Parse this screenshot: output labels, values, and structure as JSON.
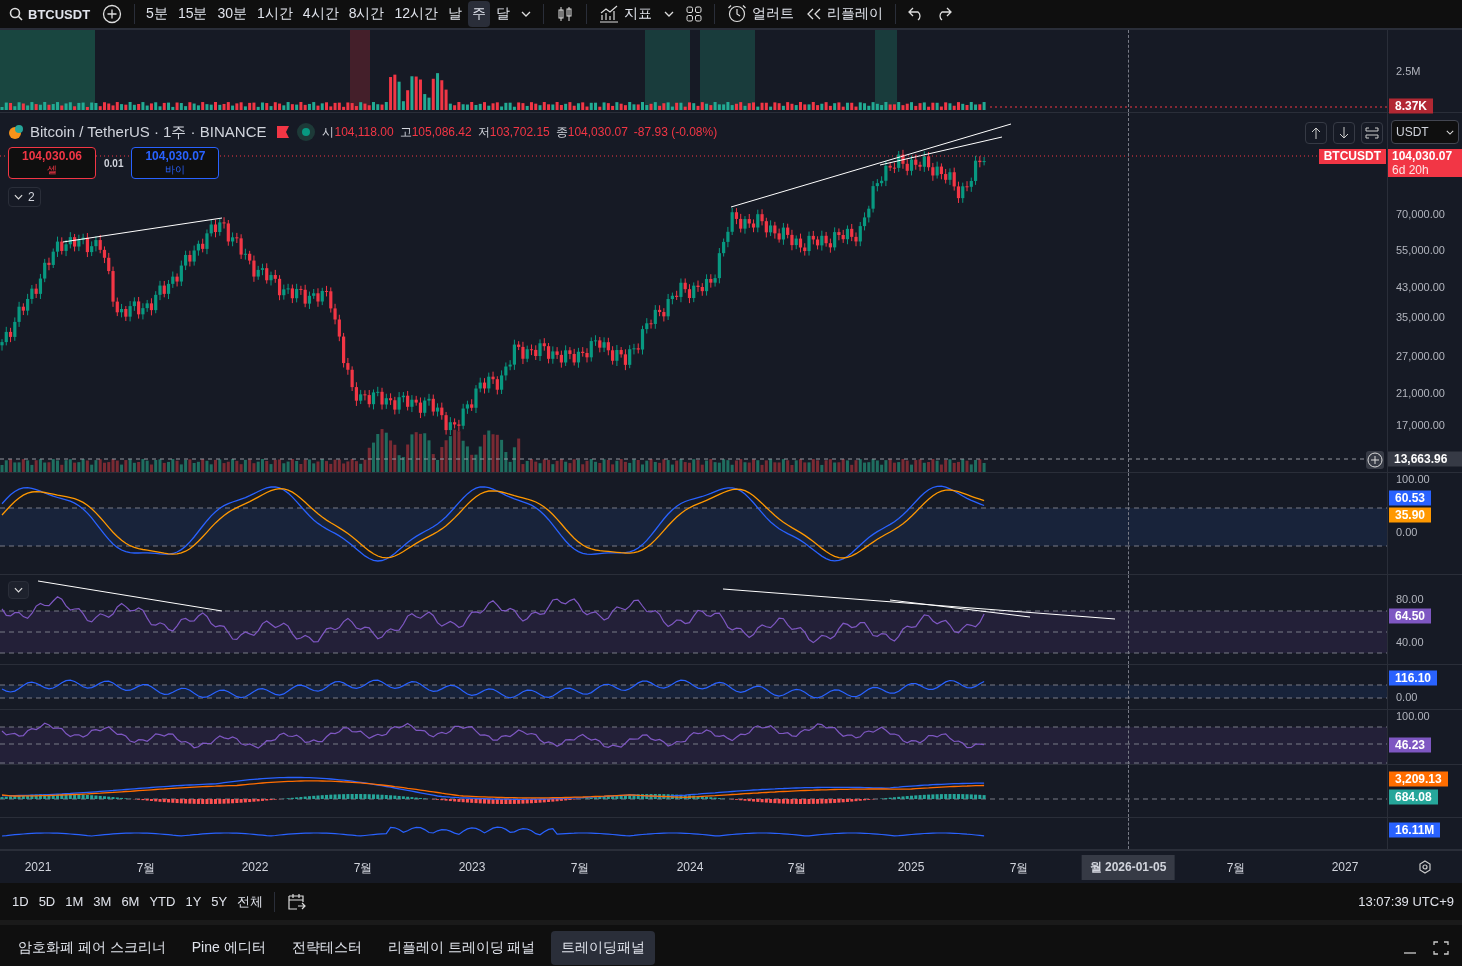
{
  "toolbar": {
    "symbol": "BTCUSDT",
    "intervals": [
      {
        "label": "5분",
        "selected": false
      },
      {
        "label": "15분",
        "selected": false
      },
      {
        "label": "30분",
        "selected": false
      },
      {
        "label": "1시간",
        "selected": false
      },
      {
        "label": "4시간",
        "selected": false
      },
      {
        "label": "8시간",
        "selected": false
      },
      {
        "label": "12시간",
        "selected": false
      },
      {
        "label": "날",
        "selected": false
      },
      {
        "label": "주",
        "selected": true
      },
      {
        "label": "달",
        "selected": false
      }
    ],
    "indicators_label": "지표",
    "alert_label": "얼러트",
    "replay_label": "리플레이"
  },
  "legend": {
    "title": "Bitcoin / TetherUS · 1주 · BINANCE",
    "ohlc": [
      {
        "label": "시",
        "value": "104,118.00"
      },
      {
        "label": "고",
        "value": "105,086.42"
      },
      {
        "label": "저",
        "value": "103,702.15"
      },
      {
        "label": "종",
        "value": "104,030.07"
      }
    ],
    "change": "-87.93 (-0.08%)",
    "sell": {
      "price": "104,030.06",
      "label": "셀"
    },
    "spread": "0.01",
    "buy": {
      "price": "104,030.07",
      "label": "바이"
    },
    "collapsed_count": "2"
  },
  "price_axis": {
    "volume_tick": "2.5M",
    "volume_badge": "8.37K",
    "currency": "USDT",
    "symbol_badge": "BTCUSDT",
    "last_price": "104,030.07",
    "countdown": "6d 20h",
    "ticks": [
      "70,000.00",
      "55,000.00",
      "43,000.00",
      "35,000.00",
      "27,000.00",
      "21,000.00",
      "17,000.00"
    ],
    "crosshair_price": "13,663.96"
  },
  "panes": [
    {
      "ticks": [
        "100.00",
        "0.00"
      ],
      "badges": [
        {
          "value": "60.53",
          "color": "#2962ff"
        },
        {
          "value": "35.90",
          "color": "#ff9800"
        }
      ]
    },
    {
      "ticks": [
        "80.00",
        "40.00"
      ],
      "badges": [
        {
          "value": "64.50",
          "color": "#7e57c2"
        }
      ]
    },
    {
      "ticks": [
        "0.00"
      ],
      "badges": [
        {
          "value": "116.10",
          "color": "#2962ff"
        }
      ]
    },
    {
      "ticks": [
        "100.00"
      ],
      "badges": [
        {
          "value": "46.23",
          "color": "#7e57c2"
        }
      ]
    },
    {
      "badges": [
        {
          "value": "3,209.13",
          "color": "#ff6d00"
        },
        {
          "value": "684.08",
          "color": "#26a69a"
        }
      ]
    },
    {
      "badges": [
        {
          "value": "16.11M",
          "color": "#2962ff"
        }
      ]
    }
  ],
  "time_axis": {
    "labels": [
      "2021",
      "7월",
      "2022",
      "7월",
      "2023",
      "7월",
      "2024",
      "7월",
      "2025",
      "7월",
      "7월",
      "2027"
    ],
    "crosshair_date": "월 2026-01-05"
  },
  "range_bar": {
    "ranges": [
      "1D",
      "5D",
      "1M",
      "3M",
      "6M",
      "YTD",
      "1Y",
      "5Y",
      "전체"
    ],
    "clock": "13:07:39 UTC+9"
  },
  "bottom_tabs": [
    {
      "label": "암호화폐 페어 스크리너",
      "selected": false
    },
    {
      "label": "Pine 에디터",
      "selected": false
    },
    {
      "label": "전략테스터",
      "selected": false
    },
    {
      "label": "리플레이 트레이딩 패널",
      "selected": false
    },
    {
      "label": "트레이딩패널",
      "selected": true
    }
  ]
}
